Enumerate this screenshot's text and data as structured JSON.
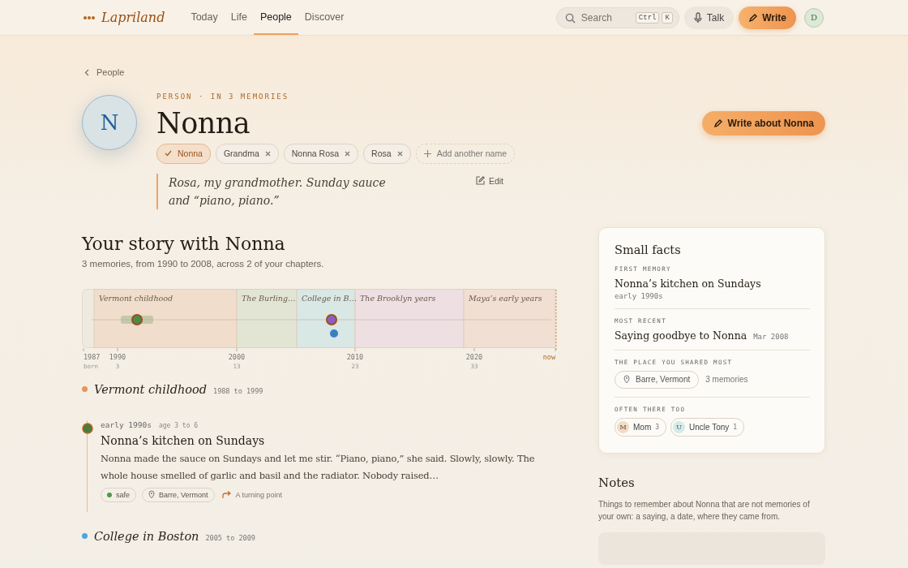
{
  "header": {
    "logo": "Lapriland",
    "nav": [
      {
        "label": "Today",
        "selected": false
      },
      {
        "label": "Life",
        "selected": false
      },
      {
        "label": "People",
        "selected": true
      },
      {
        "label": "Discover",
        "selected": false
      }
    ],
    "search": {
      "placeholder": "Search",
      "keys": [
        "Ctrl",
        "K"
      ]
    },
    "talk": "Talk",
    "write": "Write",
    "avatar": "D"
  },
  "back": "People",
  "person": {
    "initial": "N",
    "eyebrow": "PERSON · IN 3 MEMORIES",
    "name": "Nonna",
    "write_button": "Write about Nonna",
    "names": [
      {
        "label": "Nonna",
        "selected": true
      },
      {
        "label": "Grandma",
        "selected": false
      },
      {
        "label": "Nonna Rosa",
        "selected": false
      },
      {
        "label": "Rosa",
        "selected": false
      }
    ],
    "add_name": "Add another name",
    "quote": "Rosa, my grandmother. Sunday sauce and “piano, piano.”",
    "edit": "Edit"
  },
  "story": {
    "title": "Your story with Nonna",
    "subtitle": "3 memories, from 1990 to 2008, across 2 of your chapters.",
    "timeline": {
      "bands": [
        {
          "label": "Vermont childhood",
          "color": "#f0ddcb"
        },
        {
          "label": "The Burling…",
          "color": "#e2e5d4"
        },
        {
          "label": "College in B…",
          "color": "#d9e7e5"
        },
        {
          "label": "The Brooklyn years",
          "color": "#eedfe2"
        },
        {
          "label": "Maya’s early years",
          "color": "#f1dfd3"
        }
      ],
      "markers": [
        {
          "kind": "ringed",
          "color": "#4f8a4c",
          "glow": true
        },
        {
          "kind": "ringed",
          "color": "#8b5fbf",
          "glow": false
        },
        {
          "kind": "plain",
          "color": "#3a7fc1",
          "glow": false
        }
      ],
      "ticks": [
        {
          "kind": "year",
          "label": "1987",
          "note": "born"
        },
        {
          "kind": "year",
          "label": "1990",
          "note": "3"
        },
        {
          "kind": "year",
          "label": "2000",
          "note": "13"
        },
        {
          "kind": "year",
          "label": "2010",
          "note": "23"
        },
        {
          "kind": "year",
          "label": "2020",
          "note": "33"
        },
        {
          "kind": "now",
          "label": "now"
        }
      ]
    }
  },
  "chapters": [
    {
      "title": "Vermont childhood",
      "range": "1988 to 1999",
      "color": "#e8945a",
      "memories": [
        {
          "when": "early 1990s",
          "age": "age 3 to 6",
          "color": "#4f7a3a",
          "title": "Nonna’s kitchen on Sundays",
          "body": "Nonna made the sauce on Sundays and let me stir. “Piano, piano,” she said. Slowly, slowly. The whole house smelled of garlic and basil and the radiator. Nobody raised…",
          "mood": {
            "label": "safe",
            "color": "#4e9a4e"
          },
          "place": "Barre, Vermont",
          "marker": "A turning point"
        }
      ]
    },
    {
      "title": "College in Boston",
      "range": "2005 to 2009",
      "color": "#4aa8dc"
    }
  ],
  "facts": {
    "title": "Small facts",
    "sections": [
      {
        "kind": "memory",
        "label": "FIRST MEMORY",
        "title": "Nonna’s kitchen on Sundays",
        "date": "early 1990s"
      },
      {
        "kind": "inline",
        "label": "MOST RECENT",
        "title": "Saying goodbye to Nonna",
        "date": "Mar 2008"
      },
      {
        "kind": "place",
        "label": "THE PLACE YOU SHARED MOST",
        "place": "Barre, Vermont",
        "count": "3 memories"
      },
      {
        "kind": "people",
        "label": "OFTEN THERE TOO",
        "people": [
          {
            "initial": "M",
            "name": "Mom",
            "count": "3",
            "color": "#f1dcc4"
          },
          {
            "initial": "U",
            "name": "Uncle Tony",
            "count": "1",
            "color": "#d3ebea"
          }
        ]
      }
    ]
  },
  "notes": {
    "title": "Notes",
    "text": "Things to remember about Nonna that are not memories of your own: a saying, a date, where they came from."
  }
}
